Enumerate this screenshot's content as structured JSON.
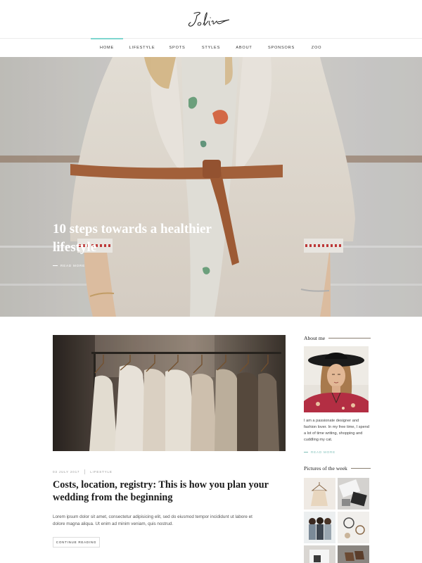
{
  "brand": {
    "logo_text": "Joline"
  },
  "nav": {
    "items": [
      {
        "label": "HOME",
        "active": true
      },
      {
        "label": "LIFESTYLE",
        "active": false
      },
      {
        "label": "SPOTS",
        "active": false
      },
      {
        "label": "STYLES",
        "active": false
      },
      {
        "label": "ABOUT",
        "active": false
      },
      {
        "label": "SPONSORS",
        "active": false
      },
      {
        "label": "ZOO",
        "active": false
      }
    ],
    "active_color": "#7fd6cf"
  },
  "hero": {
    "title": "10 steps towards a healthier lifestyle",
    "read_more": "READ MORE"
  },
  "post": {
    "date": "03 JULY 2017",
    "category": "LIFESTYLE",
    "title": "Costs, location, registry: This is how you plan your wedding from the beginning",
    "excerpt": "Lorem ipsum dolor sit amet, consectetur adipisicing elit, sed do eiusmod tempor incididunt ut labore et dolore magna aliqua. Ut enim ad minim veniam, quis nostrud.",
    "button": "CONTINUE READING"
  },
  "sidebar": {
    "about": {
      "title": "About me",
      "text": "I am a passionate designer and fashion lover. In my free time, I spend a lot of time writing, shopping and cuddling my cat.",
      "read_more": "READ MORE"
    },
    "pictures": {
      "title": "Pictures of the week"
    },
    "accent_color": "#7fbfb8"
  }
}
